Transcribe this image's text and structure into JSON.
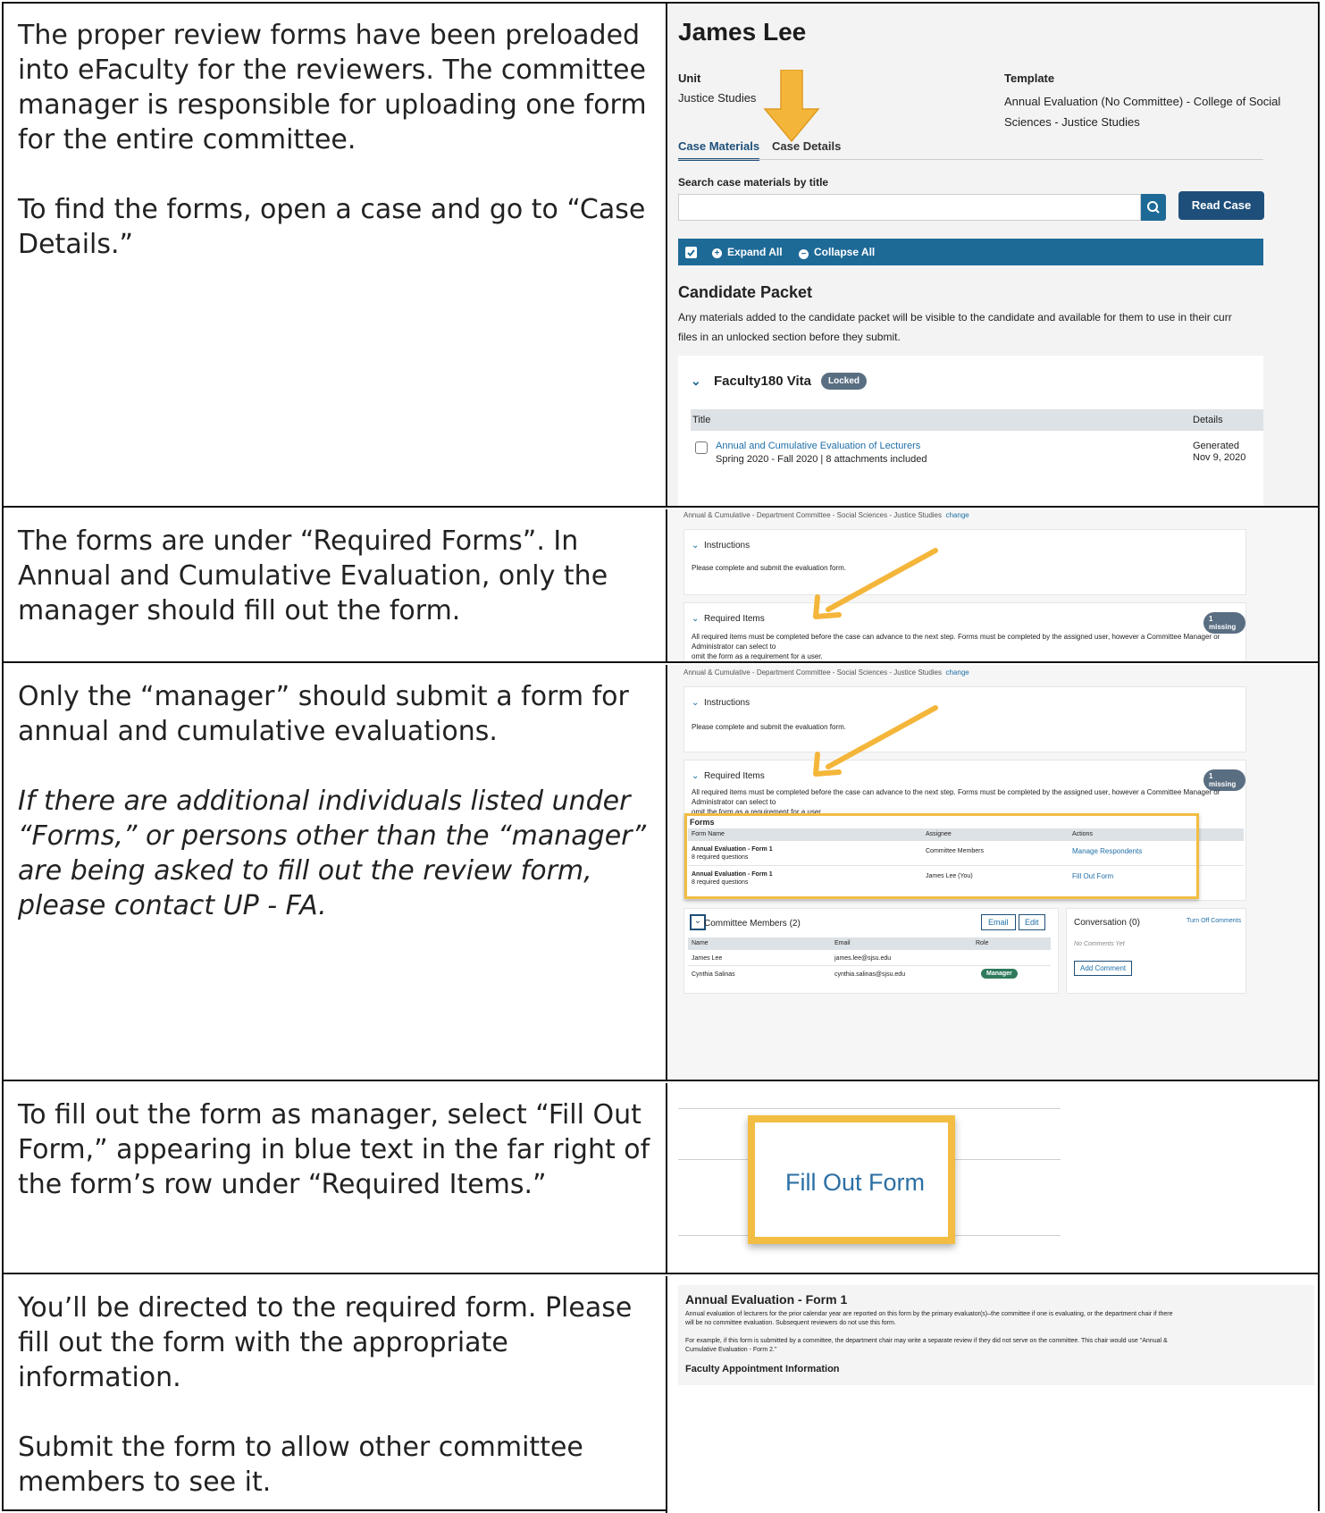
{
  "rows": [
    {
      "left_paragraphs": [
        "The proper review forms have been preloaded into eFaculty for the reviewers. The committee manager is responsible for uploading one form for the entire committee.",
        "To find the forms, open a case and go to “Case Details.”"
      ],
      "screenshot": {
        "name": "James Lee",
        "unit_label": "Unit",
        "unit_value": "Justice Studies",
        "template_label": "Template",
        "template_value_1": "Annual Evaluation (No Committee) - College of Social",
        "template_value_2": "Sciences - Justice Studies",
        "tab_materials": "Case Materials",
        "tab_details": "Case Details",
        "search_label": "Search case materials by title",
        "search_placeholder": "",
        "read_case": "Read Case",
        "expand_all": "Expand All",
        "collapse_all": "Collapse All",
        "packet_title": "Candidate Packet",
        "packet_desc_1": "Any materials added to the candidate packet will be visible to the candidate and available for them to use in their curr",
        "packet_desc_2": "files in an unlocked section before they submit.",
        "section_title": "Faculty180 Vita",
        "locked_badge": "Locked",
        "col_title": "Title",
        "col_details": "Details",
        "item_title": "Annual and Cumulative Evaluation of Lecturers",
        "item_sub": "Spring 2020 - Fall 2020 | 8 attachments included",
        "item_generated": "Generated",
        "item_date": "Nov 9, 2020"
      }
    },
    {
      "left_paragraphs": [
        "The forms are under “Required Forms”. In Annual and Cumulative Evaluation, only the manager should fill out the form."
      ],
      "screenshot": {
        "header": "Annual & Cumulative - Department Committee - Social Sciences - Justice Studies",
        "change": "change",
        "instructions": "Instructions",
        "instructions_text": "Please complete and submit the evaluation form.",
        "required_items": "Required Items",
        "missing": "1 missing",
        "required_text_1": "All required items must be completed before the case can advance to the next step. Forms must be completed by the assigned user, however a Committee Manager or Administrator can select to",
        "required_text_2": "omit the form as a requirement for a user."
      }
    },
    {
      "left_paragraphs": [
        "Only the “manager” should submit a form for annual and cumulative evaluations."
      ],
      "left_italic": "If there are additional individuals listed under “Forms,” or persons other than the “manager” are being asked to fill out the review form, please contact UP - FA.",
      "screenshot": {
        "header": "Annual & Cumulative - Department Committee - Social Sciences - Justice Studies",
        "change": "change",
        "instructions": "Instructions",
        "instructions_text": "Please complete and submit the evaluation form.",
        "required_items": "Required Items",
        "missing": "1 missing",
        "required_text_1": "All required items must be completed before the case can advance to the next step. Forms must be completed by the assigned user, however a Committee Manager or Administrator can select to",
        "required_text_2": "omit the form as a requirement for a user.",
        "forms_label": "Forms",
        "col_form_name": "Form Name",
        "col_assignee": "Assignee",
        "col_actions": "Actions",
        "form_rows": [
          {
            "name": "Annual Evaluation - Form 1",
            "sub": "8 required questions",
            "assignee": "Committee Members",
            "action": "Manage Respondents"
          },
          {
            "name": "Annual Evaluation - Form 1",
            "sub": "8 required questions",
            "assignee": "James Lee (You)",
            "action": "Fill Out Form"
          }
        ],
        "committee_title": "Committee Members (2)",
        "email_btn": "Email",
        "edit_btn": "Edit",
        "col_name": "Name",
        "col_email": "Email",
        "col_role": "Role",
        "members": [
          {
            "name": "James Lee",
            "email": "james.lee@sjsu.edu",
            "role": ""
          },
          {
            "name": "Cynthia Salinas",
            "email": "cynthia.salinas@sjsu.edu",
            "role": "Manager"
          }
        ],
        "conversation": "Conversation (0)",
        "turn_off": "Turn Off Comments",
        "no_comments": "No Comments Yet",
        "add_comment": "Add Comment"
      }
    },
    {
      "left_paragraphs": [
        "To fill out the form as manager, select “Fill Out Form,” appearing in blue text in the far right of the form’s row under “Required Items.”"
      ],
      "screenshot": {
        "fill_out_form": "Fill Out Form"
      }
    },
    {
      "left_paragraphs": [
        "You’ll be directed to the required form. Please fill out the form with the appropriate information.",
        "Submit the form to allow other committee members to see it."
      ],
      "screenshot": {
        "form_title": "Annual Evaluation - Form 1",
        "form_desc_1": "Annual evaluation of lecturers for the prior calendar year are reported on this form by the primary evaluator(s)–the committee if one is evaluating, or the department chair if there",
        "form_desc_2": "will be no committee evaluation. Subsequent reviewers do not use this form.",
        "form_example_1": "For example, if this form is submitted by a committee, the department chair may write a separate review if they did not serve on the committee. This chair would use \"Annual &",
        "form_example_2": "Cumulative Evaluation - Form 2.\"",
        "section": "Faculty Appointment Information"
      }
    }
  ],
  "colors": {
    "link": "#1f6fa8",
    "primary": "#1e4f7a",
    "bar": "#1e6a97",
    "highlight": "#f2bd42",
    "arrow": "#f4b63a"
  }
}
